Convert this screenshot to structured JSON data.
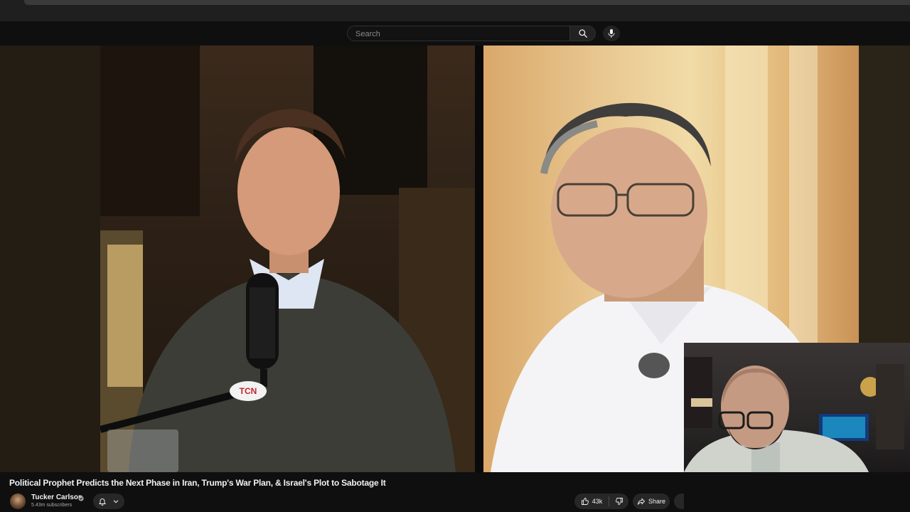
{
  "header": {
    "search_placeholder": "Search"
  },
  "player": {
    "left_feed": {
      "logo_text": "TCN"
    }
  },
  "video": {
    "title": "Political Prophet Predicts the Next Phase in Iran, Trump's War Plan, & Israel's Plot to Sabotage It",
    "channel_name": "Tucker Carlson",
    "subscribers": "5.43m subscribers",
    "likes": "43k",
    "share_label": "Share"
  },
  "icons": {
    "search": "search-icon",
    "mic": "mic-icon",
    "verified": "verified-icon",
    "bell": "bell-icon",
    "chevron": "chevron-down-icon",
    "like": "thumbs-up-icon",
    "dislike": "thumbs-down-icon",
    "share": "share-icon"
  }
}
